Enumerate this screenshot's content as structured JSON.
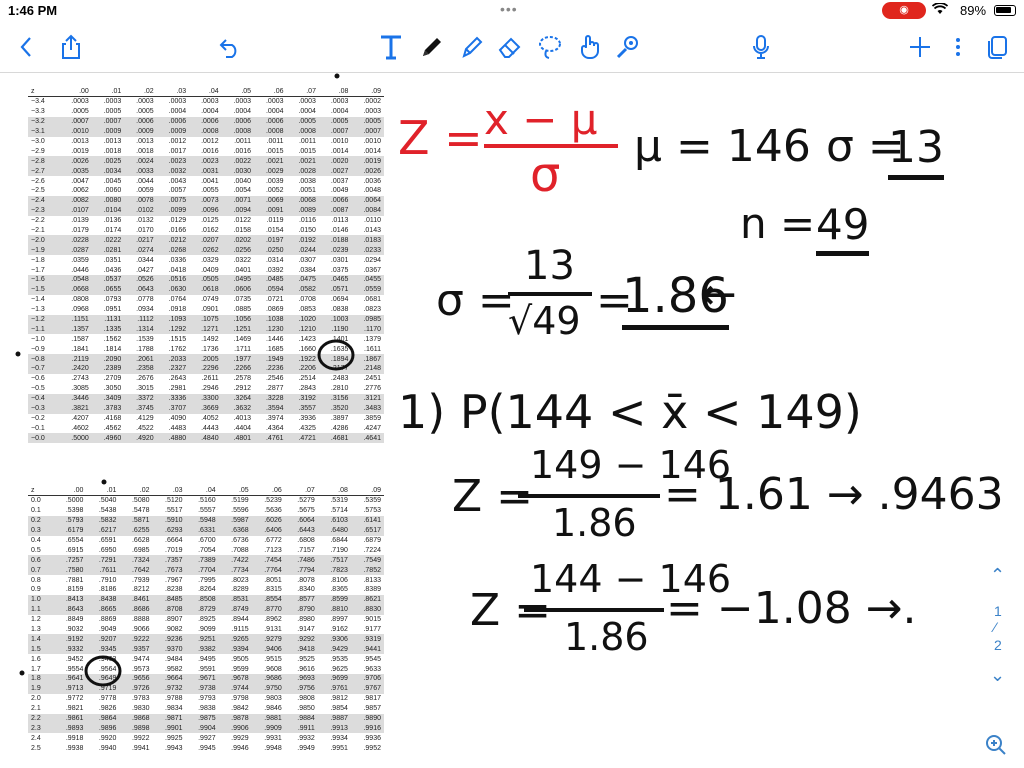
{
  "status_bar": {
    "time": "1:46 PM",
    "dots": "•••",
    "battery_percent": 89,
    "battery_text": "89%"
  },
  "toolbar": {
    "icons": [
      "back-chevron-icon",
      "share-icon",
      "undo-icon",
      "text-tool-icon",
      "pen-icon",
      "highlighter-icon",
      "eraser-icon",
      "lasso-icon",
      "hand-pointer-icon",
      "shape-icon",
      "microphone-icon",
      "add-icon",
      "more-icon",
      "pages-icon"
    ]
  },
  "table_top": {
    "header": [
      "z",
      ".00",
      ".01",
      ".02",
      ".03",
      ".04",
      ".05",
      ".06",
      ".07",
      ".08",
      ".09"
    ],
    "rows": [
      [
        "−3.4",
        ".0003",
        ".0003",
        ".0003",
        ".0003",
        ".0003",
        ".0003",
        ".0003",
        ".0003",
        ".0003",
        ".0002"
      ],
      [
        "−3.3",
        ".0005",
        ".0005",
        ".0005",
        ".0004",
        ".0004",
        ".0004",
        ".0004",
        ".0004",
        ".0004",
        ".0003"
      ],
      [
        "−3.2",
        ".0007",
        ".0007",
        ".0006",
        ".0006",
        ".0006",
        ".0006",
        ".0006",
        ".0005",
        ".0005",
        ".0005"
      ],
      [
        "−3.1",
        ".0010",
        ".0009",
        ".0009",
        ".0009",
        ".0008",
        ".0008",
        ".0008",
        ".0008",
        ".0007",
        ".0007"
      ],
      [
        "−3.0",
        ".0013",
        ".0013",
        ".0013",
        ".0012",
        ".0012",
        ".0011",
        ".0011",
        ".0011",
        ".0010",
        ".0010"
      ],
      [
        "−2.9",
        ".0019",
        ".0018",
        ".0018",
        ".0017",
        ".0016",
        ".0016",
        ".0015",
        ".0015",
        ".0014",
        ".0014"
      ],
      [
        "−2.8",
        ".0026",
        ".0025",
        ".0024",
        ".0023",
        ".0023",
        ".0022",
        ".0021",
        ".0021",
        ".0020",
        ".0019"
      ],
      [
        "−2.7",
        ".0035",
        ".0034",
        ".0033",
        ".0032",
        ".0031",
        ".0030",
        ".0029",
        ".0028",
        ".0027",
        ".0026"
      ],
      [
        "−2.6",
        ".0047",
        ".0045",
        ".0044",
        ".0043",
        ".0041",
        ".0040",
        ".0039",
        ".0038",
        ".0037",
        ".0036"
      ],
      [
        "−2.5",
        ".0062",
        ".0060",
        ".0059",
        ".0057",
        ".0055",
        ".0054",
        ".0052",
        ".0051",
        ".0049",
        ".0048"
      ],
      [
        "−2.4",
        ".0082",
        ".0080",
        ".0078",
        ".0075",
        ".0073",
        ".0071",
        ".0069",
        ".0068",
        ".0066",
        ".0064"
      ],
      [
        "−2.3",
        ".0107",
        ".0104",
        ".0102",
        ".0099",
        ".0096",
        ".0094",
        ".0091",
        ".0089",
        ".0087",
        ".0084"
      ],
      [
        "−2.2",
        ".0139",
        ".0136",
        ".0132",
        ".0129",
        ".0125",
        ".0122",
        ".0119",
        ".0116",
        ".0113",
        ".0110"
      ],
      [
        "−2.1",
        ".0179",
        ".0174",
        ".0170",
        ".0166",
        ".0162",
        ".0158",
        ".0154",
        ".0150",
        ".0146",
        ".0143"
      ],
      [
        "−2.0",
        ".0228",
        ".0222",
        ".0217",
        ".0212",
        ".0207",
        ".0202",
        ".0197",
        ".0192",
        ".0188",
        ".0183"
      ],
      [
        "−1.9",
        ".0287",
        ".0281",
        ".0274",
        ".0268",
        ".0262",
        ".0256",
        ".0250",
        ".0244",
        ".0239",
        ".0233"
      ],
      [
        "−1.8",
        ".0359",
        ".0351",
        ".0344",
        ".0336",
        ".0329",
        ".0322",
        ".0314",
        ".0307",
        ".0301",
        ".0294"
      ],
      [
        "−1.7",
        ".0446",
        ".0436",
        ".0427",
        ".0418",
        ".0409",
        ".0401",
        ".0392",
        ".0384",
        ".0375",
        ".0367"
      ],
      [
        "−1.6",
        ".0548",
        ".0537",
        ".0526",
        ".0516",
        ".0505",
        ".0495",
        ".0485",
        ".0475",
        ".0465",
        ".0455"
      ],
      [
        "−1.5",
        ".0668",
        ".0655",
        ".0643",
        ".0630",
        ".0618",
        ".0606",
        ".0594",
        ".0582",
        ".0571",
        ".0559"
      ],
      [
        "−1.4",
        ".0808",
        ".0793",
        ".0778",
        ".0764",
        ".0749",
        ".0735",
        ".0721",
        ".0708",
        ".0694",
        ".0681"
      ],
      [
        "−1.3",
        ".0968",
        ".0951",
        ".0934",
        ".0918",
        ".0901",
        ".0885",
        ".0869",
        ".0853",
        ".0838",
        ".0823"
      ],
      [
        "−1.2",
        ".1151",
        ".1131",
        ".1112",
        ".1093",
        ".1075",
        ".1056",
        ".1038",
        ".1020",
        ".1003",
        ".0985"
      ],
      [
        "−1.1",
        ".1357",
        ".1335",
        ".1314",
        ".1292",
        ".1271",
        ".1251",
        ".1230",
        ".1210",
        ".1190",
        ".1170"
      ],
      [
        "−1.0",
        ".1587",
        ".1562",
        ".1539",
        ".1515",
        ".1492",
        ".1469",
        ".1446",
        ".1423",
        ".1401",
        ".1379"
      ],
      [
        "−0.9",
        ".1841",
        ".1814",
        ".1788",
        ".1762",
        ".1736",
        ".1711",
        ".1685",
        ".1660",
        ".1635",
        ".1611"
      ],
      [
        "−0.8",
        ".2119",
        ".2090",
        ".2061",
        ".2033",
        ".2005",
        ".1977",
        ".1949",
        ".1922",
        ".1894",
        ".1867"
      ],
      [
        "−0.7",
        ".2420",
        ".2389",
        ".2358",
        ".2327",
        ".2296",
        ".2266",
        ".2236",
        ".2206",
        ".2177",
        ".2148"
      ],
      [
        "−0.6",
        ".2743",
        ".2709",
        ".2676",
        ".2643",
        ".2611",
        ".2578",
        ".2546",
        ".2514",
        ".2483",
        ".2451"
      ],
      [
        "−0.5",
        ".3085",
        ".3050",
        ".3015",
        ".2981",
        ".2946",
        ".2912",
        ".2877",
        ".2843",
        ".2810",
        ".2776"
      ],
      [
        "−0.4",
        ".3446",
        ".3409",
        ".3372",
        ".3336",
        ".3300",
        ".3264",
        ".3228",
        ".3192",
        ".3156",
        ".3121"
      ],
      [
        "−0.3",
        ".3821",
        ".3783",
        ".3745",
        ".3707",
        ".3669",
        ".3632",
        ".3594",
        ".3557",
        ".3520",
        ".3483"
      ],
      [
        "−0.2",
        ".4207",
        ".4168",
        ".4129",
        ".4090",
        ".4052",
        ".4013",
        ".3974",
        ".3936",
        ".3897",
        ".3859"
      ],
      [
        "−0.1",
        ".4602",
        ".4562",
        ".4522",
        ".4483",
        ".4443",
        ".4404",
        ".4364",
        ".4325",
        ".4286",
        ".4247"
      ],
      [
        "−0.0",
        ".5000",
        ".4960",
        ".4920",
        ".4880",
        ".4840",
        ".4801",
        ".4761",
        ".4721",
        ".4681",
        ".4641"
      ]
    ]
  },
  "table_bottom": {
    "header": [
      "z",
      ".00",
      ".01",
      ".02",
      ".03",
      ".04",
      ".05",
      ".06",
      ".07",
      ".08",
      ".09"
    ],
    "rows": [
      [
        "0.0",
        ".5000",
        ".5040",
        ".5080",
        ".5120",
        ".5160",
        ".5199",
        ".5239",
        ".5279",
        ".5319",
        ".5359"
      ],
      [
        "0.1",
        ".5398",
        ".5438",
        ".5478",
        ".5517",
        ".5557",
        ".5596",
        ".5636",
        ".5675",
        ".5714",
        ".5753"
      ],
      [
        "0.2",
        ".5793",
        ".5832",
        ".5871",
        ".5910",
        ".5948",
        ".5987",
        ".6026",
        ".6064",
        ".6103",
        ".6141"
      ],
      [
        "0.3",
        ".6179",
        ".6217",
        ".6255",
        ".6293",
        ".6331",
        ".6368",
        ".6406",
        ".6443",
        ".6480",
        ".6517"
      ],
      [
        "0.4",
        ".6554",
        ".6591",
        ".6628",
        ".6664",
        ".6700",
        ".6736",
        ".6772",
        ".6808",
        ".6844",
        ".6879"
      ],
      [
        "0.5",
        ".6915",
        ".6950",
        ".6985",
        ".7019",
        ".7054",
        ".7088",
        ".7123",
        ".7157",
        ".7190",
        ".7224"
      ],
      [
        "0.6",
        ".7257",
        ".7291",
        ".7324",
        ".7357",
        ".7389",
        ".7422",
        ".7454",
        ".7486",
        ".7517",
        ".7549"
      ],
      [
        "0.7",
        ".7580",
        ".7611",
        ".7642",
        ".7673",
        ".7704",
        ".7734",
        ".7764",
        ".7794",
        ".7823",
        ".7852"
      ],
      [
        "0.8",
        ".7881",
        ".7910",
        ".7939",
        ".7967",
        ".7995",
        ".8023",
        ".8051",
        ".8078",
        ".8106",
        ".8133"
      ],
      [
        "0.9",
        ".8159",
        ".8186",
        ".8212",
        ".8238",
        ".8264",
        ".8289",
        ".8315",
        ".8340",
        ".8365",
        ".8389"
      ],
      [
        "1.0",
        ".8413",
        ".8438",
        ".8461",
        ".8485",
        ".8508",
        ".8531",
        ".8554",
        ".8577",
        ".8599",
        ".8621"
      ],
      [
        "1.1",
        ".8643",
        ".8665",
        ".8686",
        ".8708",
        ".8729",
        ".8749",
        ".8770",
        ".8790",
        ".8810",
        ".8830"
      ],
      [
        "1.2",
        ".8849",
        ".8869",
        ".8888",
        ".8907",
        ".8925",
        ".8944",
        ".8962",
        ".8980",
        ".8997",
        ".9015"
      ],
      [
        "1.3",
        ".9032",
        ".9049",
        ".9066",
        ".9082",
        ".9099",
        ".9115",
        ".9131",
        ".9147",
        ".9162",
        ".9177"
      ],
      [
        "1.4",
        ".9192",
        ".9207",
        ".9222",
        ".9236",
        ".9251",
        ".9265",
        ".9279",
        ".9292",
        ".9306",
        ".9319"
      ],
      [
        "1.5",
        ".9332",
        ".9345",
        ".9357",
        ".9370",
        ".9382",
        ".9394",
        ".9406",
        ".9418",
        ".9429",
        ".9441"
      ],
      [
        "1.6",
        ".9452",
        ".9463",
        ".9474",
        ".9484",
        ".9495",
        ".9505",
        ".9515",
        ".9525",
        ".9535",
        ".9545"
      ],
      [
        "1.7",
        ".9554",
        ".9564",
        ".9573",
        ".9582",
        ".9591",
        ".9599",
        ".9608",
        ".9616",
        ".9625",
        ".9633"
      ],
      [
        "1.8",
        ".9641",
        ".9649",
        ".9656",
        ".9664",
        ".9671",
        ".9678",
        ".9686",
        ".9693",
        ".9699",
        ".9706"
      ],
      [
        "1.9",
        ".9713",
        ".9719",
        ".9726",
        ".9732",
        ".9738",
        ".9744",
        ".9750",
        ".9756",
        ".9761",
        ".9767"
      ],
      [
        "2.0",
        ".9772",
        ".9778",
        ".9783",
        ".9788",
        ".9793",
        ".9798",
        ".9803",
        ".9808",
        ".9812",
        ".9817"
      ],
      [
        "2.1",
        ".9821",
        ".9826",
        ".9830",
        ".9834",
        ".9838",
        ".9842",
        ".9846",
        ".9850",
        ".9854",
        ".9857"
      ],
      [
        "2.2",
        ".9861",
        ".9864",
        ".9868",
        ".9871",
        ".9875",
        ".9878",
        ".9881",
        ".9884",
        ".9887",
        ".9890"
      ],
      [
        "2.3",
        ".9893",
        ".9896",
        ".9898",
        ".9901",
        ".9904",
        ".9906",
        ".9909",
        ".9911",
        ".9913",
        ".9916"
      ],
      [
        "2.4",
        ".9918",
        ".9920",
        ".9922",
        ".9925",
        ".9927",
        ".9929",
        ".9931",
        ".9932",
        ".9934",
        ".9936"
      ],
      [
        "2.5",
        ".9938",
        ".9940",
        ".9941",
        ".9943",
        ".9945",
        ".9946",
        ".9948",
        ".9949",
        ".9951",
        ".9952"
      ]
    ]
  },
  "notes": {
    "formula_z": "Z = ",
    "formula_num": "x − μ",
    "formula_den": "σ",
    "mu": "μ = 146",
    "sigma_label": "σ = ",
    "sigma_value": "13",
    "n_label": "n = ",
    "n_value": "49",
    "se_lhs": "σ =",
    "se_num": "13",
    "se_den": "√49",
    "se_eq": "=",
    "se_result": "1.86",
    "arrow": "←",
    "prob": "1) P(144 < x̄ < 149)",
    "z1_lhs": "Z =",
    "z1_num": "149 − 146",
    "z1_den": "1.86",
    "z1_result": "= 1.61 → .9463",
    "z2_lhs": "Z =",
    "z2_num": "144 − 146",
    "z2_den": "1.86",
    "z2_result": "= −1.08 →."
  },
  "page_nav": {
    "up": "⌃",
    "current": "1",
    "separator": "⁄",
    "total": "2",
    "down": "⌄",
    "zoom": "zoom-icon"
  },
  "colors": {
    "accent": "#1a73e8",
    "ink": "#111111",
    "red_ink": "#e0222a",
    "record": "#e0261d",
    "shade": "#dcdcdc"
  }
}
